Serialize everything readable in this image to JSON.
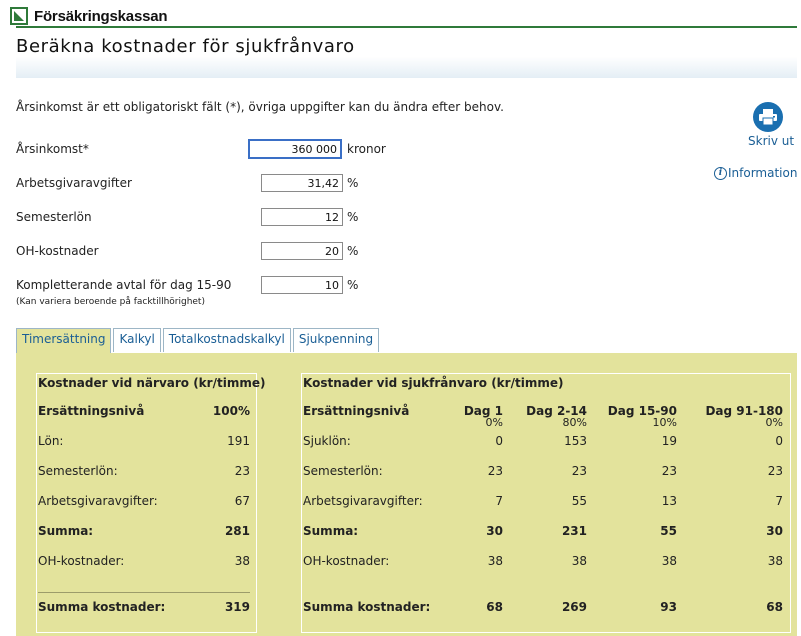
{
  "brand": {
    "name": "Försäkringskassan"
  },
  "page": {
    "title": "Beräkna kostnader för sjukfrånvaro",
    "intro": "Årsinkomst är ett obligatoriskt fält (*), övriga uppgifter kan du ändra efter behov."
  },
  "actions": {
    "print_label": "Skriv ut",
    "info_label": "Information",
    "print_icon": "printer-icon",
    "info_icon": "info-icon"
  },
  "form": {
    "annual_income": {
      "label": "Årsinkomst*",
      "value": "360 000",
      "unit": "kronor"
    },
    "employer_fees": {
      "label": "Arbetsgivaravgifter",
      "value": "31,42",
      "unit": "%"
    },
    "vacation_pay": {
      "label": "Semesterlön",
      "value": "12",
      "unit": "%"
    },
    "overhead": {
      "label": "OH-kostnader",
      "value": "20",
      "unit": "%"
    },
    "supplementary": {
      "label": "Kompletterande avtal för dag 15-90",
      "note": "(Kan variera beroende på facktillhörighet)",
      "value": "10",
      "unit": "%"
    }
  },
  "tabs": [
    {
      "label": "Timersättning",
      "active": true
    },
    {
      "label": "Kalkyl",
      "active": false
    },
    {
      "label": "Totalkostnadskalkyl",
      "active": false
    },
    {
      "label": "Sjukpenning",
      "active": false
    }
  ],
  "presence": {
    "heading": "Kostnader vid närvaro (kr/timme)",
    "level_label": "Ersättningsnivå",
    "level_value": "100%",
    "rows": [
      {
        "label": "Lön:",
        "value": "191"
      },
      {
        "label": "Semesterlön:",
        "value": "23"
      },
      {
        "label": "Arbetsgivaravgifter:",
        "value": "67"
      },
      {
        "label": "Summa:",
        "value": "281"
      },
      {
        "label": "OH-kostnader:",
        "value": "38"
      }
    ],
    "total": {
      "label": "Summa kostnader:",
      "value": "319"
    }
  },
  "absence": {
    "heading": "Kostnader vid sjukfrånvaro (kr/timme)",
    "level_label": "Ersättningsnivå",
    "columns": [
      {
        "day": "Dag 1",
        "pct": "0%"
      },
      {
        "day": "Dag 2-14",
        "pct": "80%"
      },
      {
        "day": "Dag 15-90",
        "pct": "10%"
      },
      {
        "day": "Dag 91-180",
        "pct": "0%"
      }
    ],
    "rows": [
      {
        "label": "Sjuklön:",
        "values": [
          "0",
          "153",
          "19",
          "0"
        ]
      },
      {
        "label": "Semesterlön:",
        "values": [
          "23",
          "23",
          "23",
          "23"
        ]
      },
      {
        "label": "Arbetsgivaravgifter:",
        "values": [
          "7",
          "55",
          "13",
          "7"
        ]
      },
      {
        "label": "Summa:",
        "values": [
          "30",
          "231",
          "55",
          "30"
        ]
      },
      {
        "label": "OH-kostnader:",
        "values": [
          "38",
          "38",
          "38",
          "38"
        ]
      }
    ],
    "total": {
      "label": "Summa kostnader:",
      "values": [
        "68",
        "269",
        "93",
        "68"
      ]
    }
  }
}
